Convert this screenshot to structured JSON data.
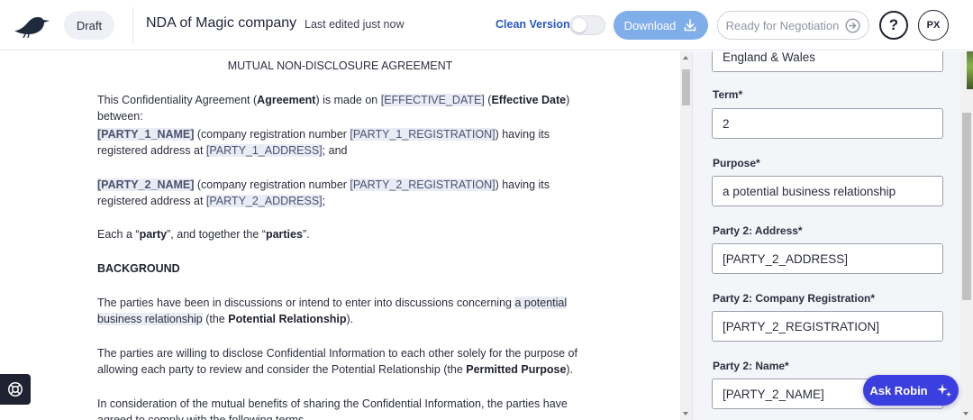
{
  "header": {
    "status_pill": "Draft",
    "document_title": "NDA of Magic company",
    "last_edited": "Last edited just now",
    "clean_version_label": "Clean Version",
    "download_label": "Download",
    "negotiation_label": "Ready for Negotiation",
    "help_glyph": "?",
    "avatar_initials": "PX",
    "icons": [
      "bird-logo-icon",
      "download-icon",
      "arrow-right-circle-icon",
      "help-icon"
    ]
  },
  "document": {
    "heading": "MUTUAL NON-DISCLOSURE AGREEMENT",
    "p1": {
      "t1": "This Confidentiality Agreement (",
      "agreement": "Agreement",
      "t2": ") is made on ",
      "effective_date_ph": "[EFFECTIVE_DATE]",
      "t3": " (",
      "effective_date": "Effective Date",
      "t4": ") between:"
    },
    "p2": {
      "party_name": "[PARTY_1_NAME]",
      "t1": " (company registration number ",
      "registration": "[PARTY_1_REGISTRATION]",
      "t2": ") having its registered address at ",
      "address": "[PARTY_1_ADDRESS]",
      "t3": "; and"
    },
    "p3": {
      "party_name": "[PARTY_2_NAME]",
      "t1": " (company registration number ",
      "registration": "[PARTY_2_REGISTRATION]",
      "t2": ") having its registered address at ",
      "address": "[PARTY_2_ADDRESS]",
      "t3": ";"
    },
    "p4": {
      "t1": "Each a “",
      "party": "party",
      "t2": "”, and together the “",
      "parties": "parties",
      "t3": "”."
    },
    "background_heading": "BACKGROUND",
    "p5": {
      "t1": "The parties have been in discussions or intend to enter into discussions concerning ",
      "purpose": "a potential business relationship",
      "t2": " (the ",
      "defined": "Potential Relationship",
      "t3": ")."
    },
    "p6": {
      "t1": "The parties are willing to disclose Confidential Information to each other solely for the purpose of allowing each party to review and consider the Potential Relationship (the ",
      "defined": "Permitted Purpose",
      "t2": ")."
    },
    "p7": {
      "t1": "In consideration of the mutual benefits of sharing the Confidential Information, the parties have agreed to comply with the following terms."
    }
  },
  "panel": {
    "top_value": "England & Wales",
    "fields": [
      {
        "label": "Term*",
        "value": "2"
      },
      {
        "label": "Purpose*",
        "value": "a potential business relationship"
      },
      {
        "label": "Party 2: Address*",
        "value": "[PARTY_2_ADDRESS]"
      },
      {
        "label": "Party 2: Company Registration*",
        "value": "[PARTY_2_REGISTRATION]"
      },
      {
        "label": "Party 2: Name*",
        "value": "[PARTY_2_NAME]"
      }
    ]
  },
  "floating": {
    "ask_robin_label": "Ask Robin"
  },
  "colors": {
    "accent": "#2a58c9",
    "download_bg": "#80aeea",
    "ask_robin_bg": "#3c3fe0",
    "placeholder_bg": "#e9ecf4"
  }
}
